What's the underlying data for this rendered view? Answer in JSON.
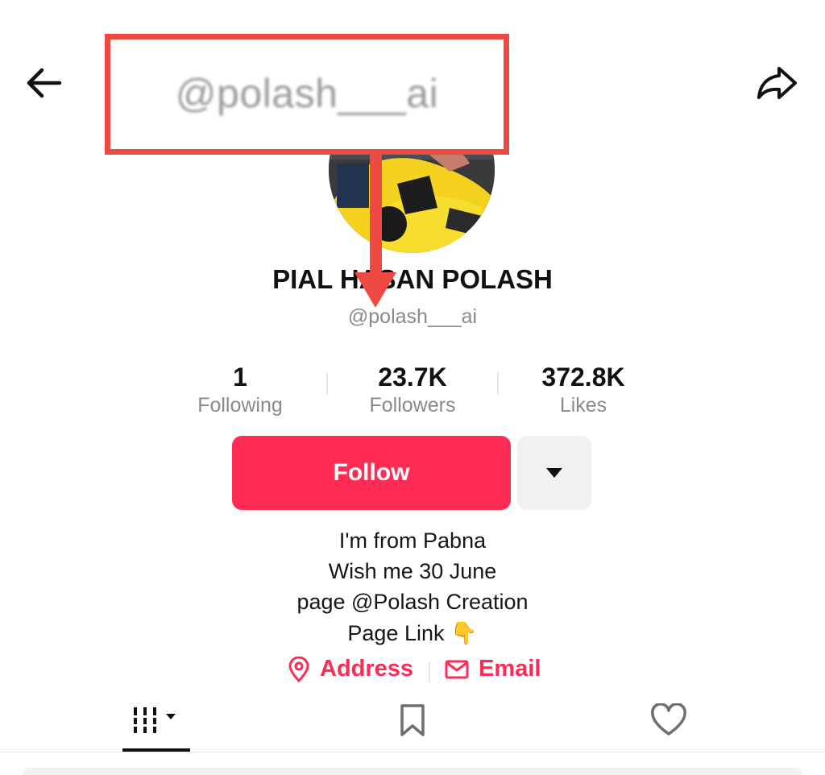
{
  "header": {
    "username": "@polash___ai"
  },
  "profile": {
    "display_name": "PIAL HASAN POLASH",
    "handle": "@polash___ai"
  },
  "stats": [
    {
      "value": "1",
      "label": "Following"
    },
    {
      "value": "23.7K",
      "label": "Followers"
    },
    {
      "value": "372.8K",
      "label": "Likes"
    }
  ],
  "actions": {
    "follow_label": "Follow"
  },
  "bio": [
    "I'm from Pabna",
    "Wish me 30 June",
    "page @Polash Creation",
    "Page Link 👇"
  ],
  "links": {
    "address_label": "Address",
    "email_label": "Email"
  },
  "tabs": [
    {
      "name": "videos",
      "icon": "grid-icon"
    },
    {
      "name": "saved",
      "icon": "bookmark-icon"
    },
    {
      "name": "liked",
      "icon": "heart-icon"
    }
  ],
  "colors": {
    "accent": "#fe2c55",
    "highlight_box": "#ee4a43",
    "muted_text": "#8a8a8a"
  },
  "icons": [
    "back-arrow-icon",
    "share-icon",
    "chevron-down-icon",
    "location-pin-icon",
    "envelope-icon",
    "grid-icon",
    "bookmark-icon",
    "heart-icon",
    "annotation-arrow"
  ]
}
